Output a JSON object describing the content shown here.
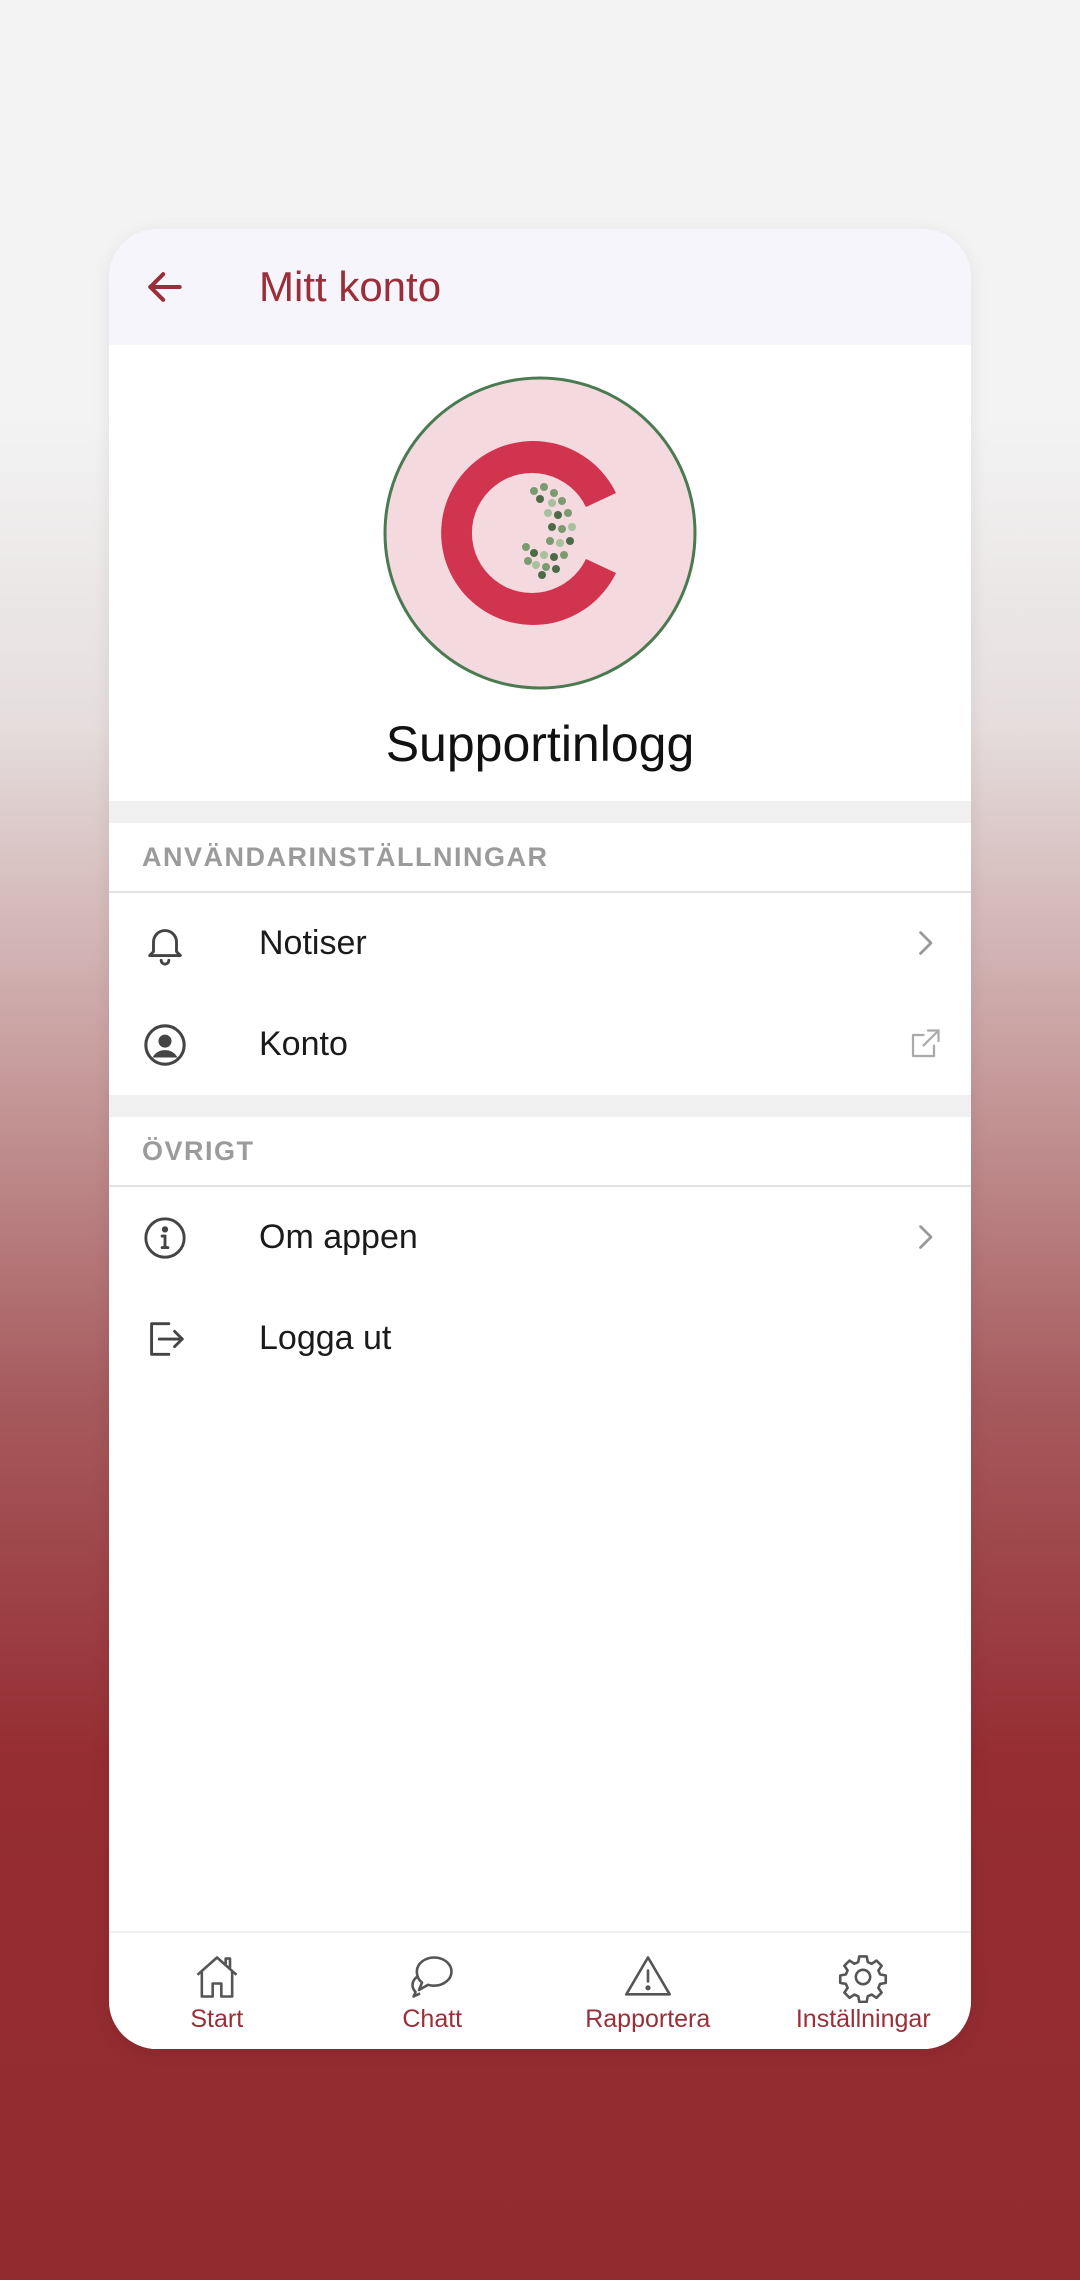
{
  "header": {
    "title": "Mitt konto",
    "back_icon": "arrow-left-icon"
  },
  "profile": {
    "name": "Supportinlogg"
  },
  "sections": [
    {
      "title": "ANVÄNDARINSTÄLLNINGAR",
      "items": [
        {
          "label": "Notiser",
          "icon": "bell-icon",
          "trail": "chevron-right-icon"
        },
        {
          "label": "Konto",
          "icon": "user-circle-icon",
          "trail": "external-link-icon"
        }
      ]
    },
    {
      "title": "ÖVRIGT",
      "items": [
        {
          "label": "Om appen",
          "icon": "info-icon",
          "trail": "chevron-right-icon"
        },
        {
          "label": "Logga ut",
          "icon": "logout-icon"
        }
      ]
    }
  ],
  "nav": [
    {
      "label": "Start",
      "icon": "home-icon"
    },
    {
      "label": "Chatt",
      "icon": "chat-icon"
    },
    {
      "label": "Rapportera",
      "icon": "warning-icon"
    },
    {
      "label": "Inställningar",
      "icon": "gear-icon"
    }
  ],
  "colors": {
    "accent": "#9b2e38",
    "logo_red": "#d1344f",
    "logo_bg": "#f4d9df",
    "logo_ring": "#4a7a4f"
  }
}
